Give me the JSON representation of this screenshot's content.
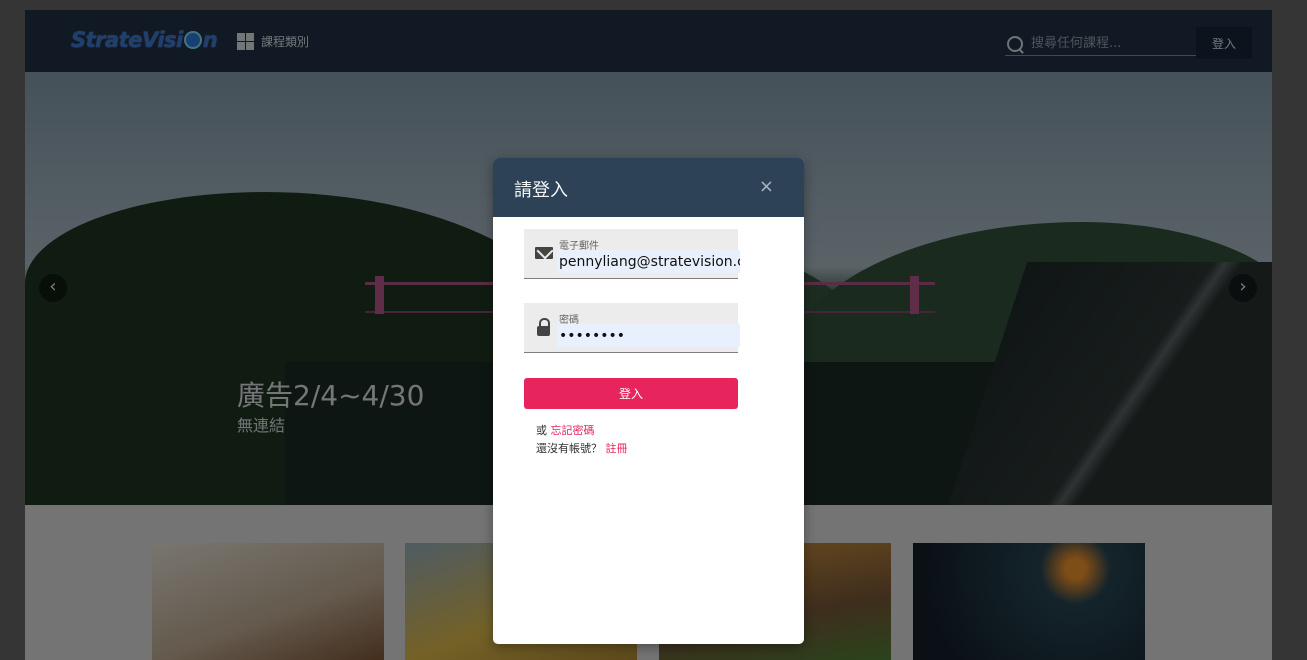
{
  "header": {
    "logo_part1": "StrateVisi",
    "logo_part2": "n",
    "category_label": "課程類別",
    "search_placeholder": "搜尋任何課程...",
    "login_label": "登入"
  },
  "hero": {
    "title": "廣告2/4~4/30",
    "subtitle": "無連結",
    "prev_icon": "‹",
    "next_icon": "›"
  },
  "modal": {
    "title": "請登入",
    "close_icon": "×",
    "email_label": "電子郵件",
    "email_value": "pennyliang@stratevision.co",
    "password_label": "密碼",
    "password_value": "••••••••",
    "submit_label": "登入",
    "forgot_prefix": "或",
    "forgot_link": "忘記密碼",
    "signup_prefix": "還沒有帳號？",
    "signup_link": "註冊"
  },
  "colors": {
    "header_bg": "#223548",
    "modal_header_bg": "#2d4257",
    "accent": "#e8245c"
  },
  "icons": [
    "grid-icon",
    "search-icon",
    "mail-icon",
    "lock-icon",
    "close-icon",
    "chevron-left-icon",
    "chevron-right-icon"
  ]
}
